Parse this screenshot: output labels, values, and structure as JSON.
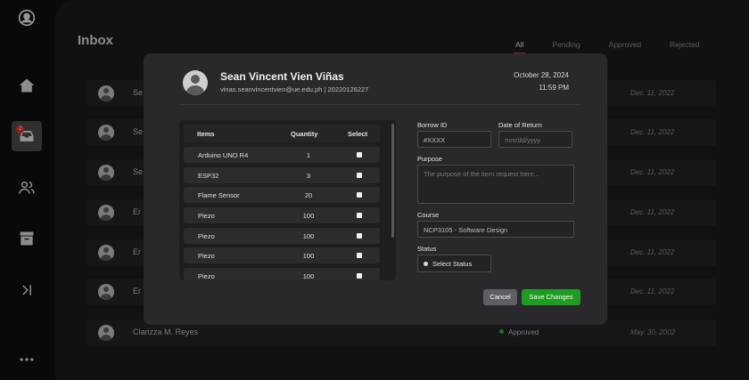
{
  "inbox": {
    "title": "Inbox",
    "tabs": [
      "All",
      "Pending",
      "Approved",
      "Rejected"
    ],
    "rows": [
      {
        "name": "Se",
        "date": "Dec. 11, 2022"
      },
      {
        "name": "Se",
        "date": "Dec. 11, 2022"
      },
      {
        "name": "Se",
        "date": "Dec. 11, 2022"
      },
      {
        "name": "Er",
        "date": "Dec. 11, 2022"
      },
      {
        "name": "Er",
        "date": "Dec. 11, 2022"
      },
      {
        "name": "Er",
        "date": "Dec. 11, 2022"
      }
    ],
    "last_row": {
      "name": "Clarizza M. Reyes",
      "status": "Approved",
      "date": "May. 30, 2002"
    }
  },
  "sidebar": {
    "badge": "2",
    "icons": [
      "user-circle-icon",
      "home-icon",
      "inbox-icon",
      "users-icon",
      "archive-icon",
      "collapse-icon",
      "more-icon"
    ]
  },
  "modal": {
    "name": "Sean Vincent Vien Viñas",
    "email_line": "vinas.seanvincentvien@ue.edu.ph  |  20220126227",
    "date": "October 28, 2024",
    "time": "11:59 PM",
    "table": {
      "headers": [
        "Items",
        "Quantity",
        "Select"
      ],
      "rows": [
        {
          "item": "Arduino UNO R4",
          "qty": "1"
        },
        {
          "item": "ESP32",
          "qty": "3"
        },
        {
          "item": "Flame Sensor",
          "qty": "20"
        },
        {
          "item": "Piezo",
          "qty": "100"
        },
        {
          "item": "Piezo",
          "qty": "100"
        },
        {
          "item": "Piezo",
          "qty": "100"
        },
        {
          "item": "Piezo",
          "qty": "100"
        }
      ]
    },
    "form": {
      "borrow_id_label": "Borrow ID",
      "borrow_id_value": "#XXXX",
      "return_label": "Date of Return",
      "return_placeholder": "mm/dd/yyyy",
      "purpose_label": "Purpose",
      "purpose_placeholder": "The purpose of the item request here...",
      "course_label": "Course",
      "course_value": "NCP3105 - Software Design",
      "status_label": "Status",
      "status_value": "Select Status"
    },
    "cancel_label": "Cancel",
    "save_label": "Save Changes"
  }
}
